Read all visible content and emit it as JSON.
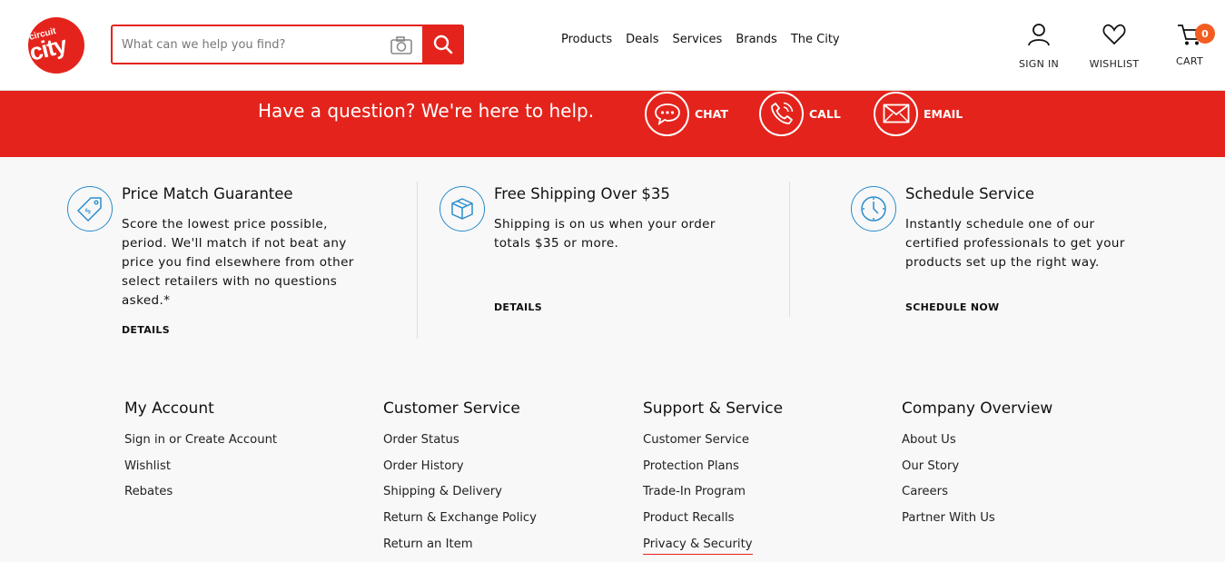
{
  "brand": {
    "logo_text": "circuit city",
    "accent": "#e4241c",
    "badge_color": "#f45d22",
    "icon_blue": "#2a8ccc"
  },
  "search": {
    "placeholder": "What can we help you find?"
  },
  "nav": [
    "Products",
    "Deals",
    "Services",
    "Brands",
    "The City"
  ],
  "header_actions": {
    "sign_in": "SIGN IN",
    "wishlist": "WISHLIST",
    "cart": "CART",
    "cart_count": "0"
  },
  "banner": {
    "text": "Have a question? We're here to help.",
    "chat": "CHAT",
    "call": "CALL",
    "email": "EMAIL"
  },
  "props": [
    {
      "icon": "price-tag-icon",
      "title": "Price Match Guarantee",
      "body": [
        "Score the lowest price possible,",
        "period. We'll match if not beat any",
        "price you find elsewhere from other",
        "select retailers with no questions",
        "asked.*"
      ],
      "link": "DETAILS"
    },
    {
      "icon": "box-icon",
      "title": "Free Shipping Over $35",
      "body": [
        "Shipping is on us when your order",
        "totals $35 or more."
      ],
      "link": "DETAILS"
    },
    {
      "icon": "clock-icon",
      "title": "Schedule Service",
      "body": [
        "Instantly schedule one of our",
        "certified professionals to get your",
        "products set up the right way."
      ],
      "link": "SCHEDULE NOW"
    }
  ],
  "footer": [
    {
      "title": "My Account",
      "links": [
        "Sign in or Create Account",
        "Wishlist",
        "Rebates"
      ]
    },
    {
      "title": "Customer Service",
      "links": [
        "Order Status",
        "Order History",
        "Shipping & Delivery",
        "Return & Exchange Policy",
        "Return an Item"
      ]
    },
    {
      "title": "Support & Service",
      "links": [
        "Customer Service",
        "Protection Plans",
        "Trade-In Program",
        "Product Recalls",
        "Privacy & Security"
      ]
    },
    {
      "title": "Company Overview",
      "links": [
        "About Us",
        "Our Story",
        "Careers",
        "Partner With Us"
      ]
    }
  ]
}
